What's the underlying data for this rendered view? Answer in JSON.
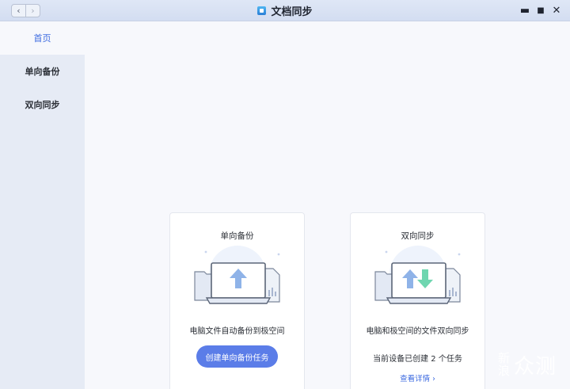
{
  "titlebar": {
    "title": "文档同步",
    "back": "‹",
    "forward": "›",
    "minimize": "▬",
    "maximize": "■",
    "close": "✕"
  },
  "sidebar": {
    "items": [
      {
        "label": "首页",
        "active": true
      },
      {
        "label": "单向备份",
        "active": false
      },
      {
        "label": "双向同步",
        "active": false
      }
    ]
  },
  "cards": {
    "backup": {
      "title": "单向备份",
      "description": "电脑文件自动备份到极空间",
      "button_label": "创建单向备份任务"
    },
    "sync": {
      "title": "双向同步",
      "description": "电脑和极空间的文件双向同步",
      "count_text": "当前设备已创建 2 个任务",
      "detail_link": "查看详情 ›"
    }
  },
  "watermark": {
    "small_line1": "新",
    "small_line2": "浪",
    "big": "众测"
  },
  "colors": {
    "accent": "#5b7de8",
    "link": "#3d6be0",
    "sidebar_bg": "#e6ebf5",
    "upload_arrow": "#8fb3e8",
    "download_arrow": "#6fd6b0"
  }
}
